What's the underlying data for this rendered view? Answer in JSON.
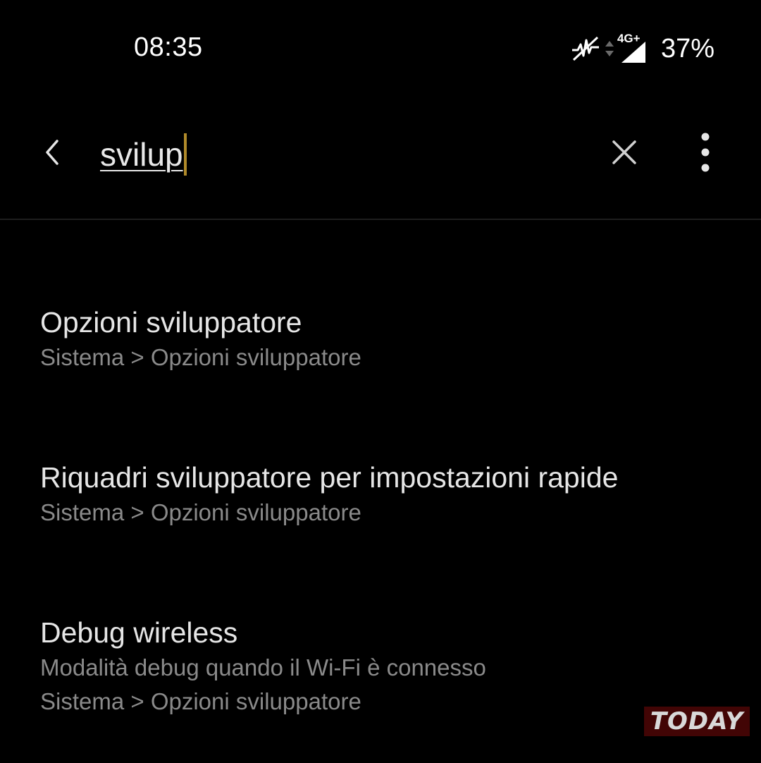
{
  "status_bar": {
    "time": "08:35",
    "network_label": "4G+",
    "battery": "37%",
    "icons": [
      "activity-off-icon",
      "data-arrows-icon",
      "signal-icon"
    ]
  },
  "search": {
    "query": "svilup",
    "back_icon": "chevron-left-icon",
    "clear_icon": "close-icon",
    "more_icon": "more-vertical-icon",
    "cursor_color": "#b08a2a"
  },
  "results": [
    {
      "title": "Opzioni sviluppatore",
      "path": "Sistema > Opzioni sviluppatore"
    },
    {
      "title": "Riquadri sviluppatore per impostazioni rapide",
      "path": "Sistema > Opzioni sviluppatore"
    },
    {
      "title": "Debug wireless",
      "summary": "Modalità debug quando il Wi-Fi è connesso",
      "path": "Sistema > Opzioni sviluppatore"
    }
  ],
  "watermark": "TODAY"
}
